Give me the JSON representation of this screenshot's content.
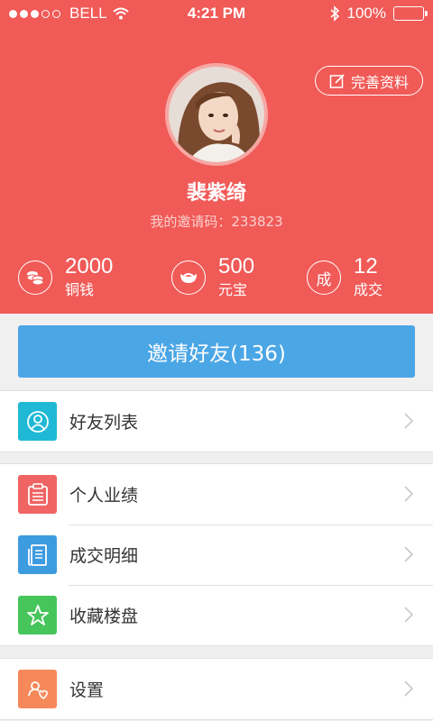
{
  "status_bar": {
    "carrier": "BELL",
    "time": "4:21 PM",
    "battery": "100%"
  },
  "profile": {
    "edit_label": "完善资料",
    "name": "裴紫绮",
    "invite_code": "我的邀请码：233823"
  },
  "stats": [
    {
      "value": "2000",
      "label": "铜钱",
      "icon": "coins-icon"
    },
    {
      "value": "500",
      "label": "元宝",
      "icon": "ingot-icon"
    },
    {
      "value": "12",
      "label": "成交",
      "icon_text": "成"
    }
  ],
  "invite_button": "邀请好友(136)",
  "menu": {
    "friends": "好友列表",
    "performance": "个人业绩",
    "deals": "成交明细",
    "favorites": "收藏楼盘",
    "settings": "设置"
  },
  "colors": {
    "header": "#f05a57",
    "invite": "#4ba6e6",
    "friends_icon": "#1fb9d6",
    "performance_icon": "#f06464",
    "deals_icon": "#3d9be0",
    "favorites_icon": "#46c55a",
    "settings_icon": "#f6895a"
  }
}
